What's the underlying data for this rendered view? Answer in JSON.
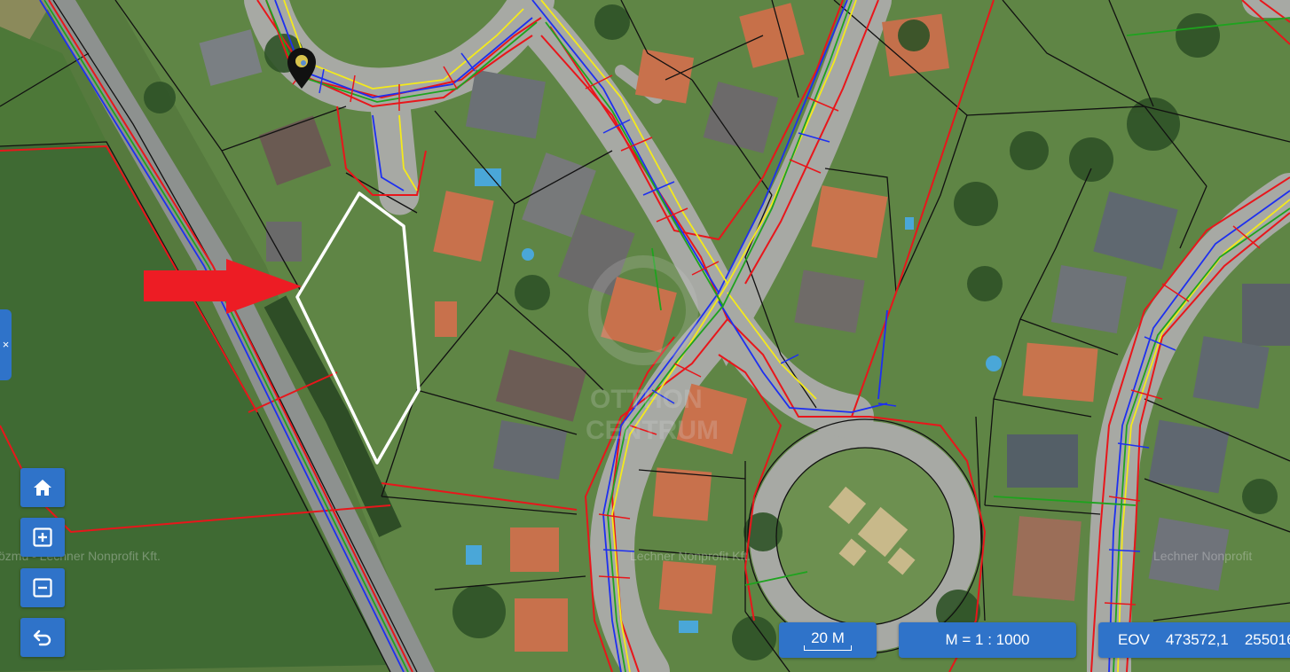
{
  "map": {
    "watermarks": {
      "left": "özmű - Lechner Nonprofit Kft.",
      "center": "Lechner Nonprofit Kft.",
      "right": "Lechner Nonprofit"
    },
    "logo_text": {
      "line1": "OTTHON",
      "line2": "CENTRUM"
    },
    "colors": {
      "accent_blue": "#2f73c9",
      "arrow_red": "#ed1c24",
      "parcel_outline_white": "#ffffff",
      "utility_red": "#e8161b",
      "utility_blue": "#1d2ff0",
      "utility_yellow": "#f4ea1b",
      "utility_green": "#1ea31e"
    },
    "icons": {
      "location_pin": "map-pin-icon",
      "arrow": "red-arrow"
    }
  },
  "controls": {
    "side_tab_glyph": "×",
    "home": "home-icon",
    "zoom_in": "zoom-in-icon",
    "zoom_out": "zoom-out-icon",
    "undo": "undo-icon"
  },
  "status": {
    "scale_label": "20 M",
    "ratio_label": "M = 1 : 1000",
    "coord_system": "EOV",
    "coord_x": "473572,1",
    "coord_y": "255016,"
  }
}
